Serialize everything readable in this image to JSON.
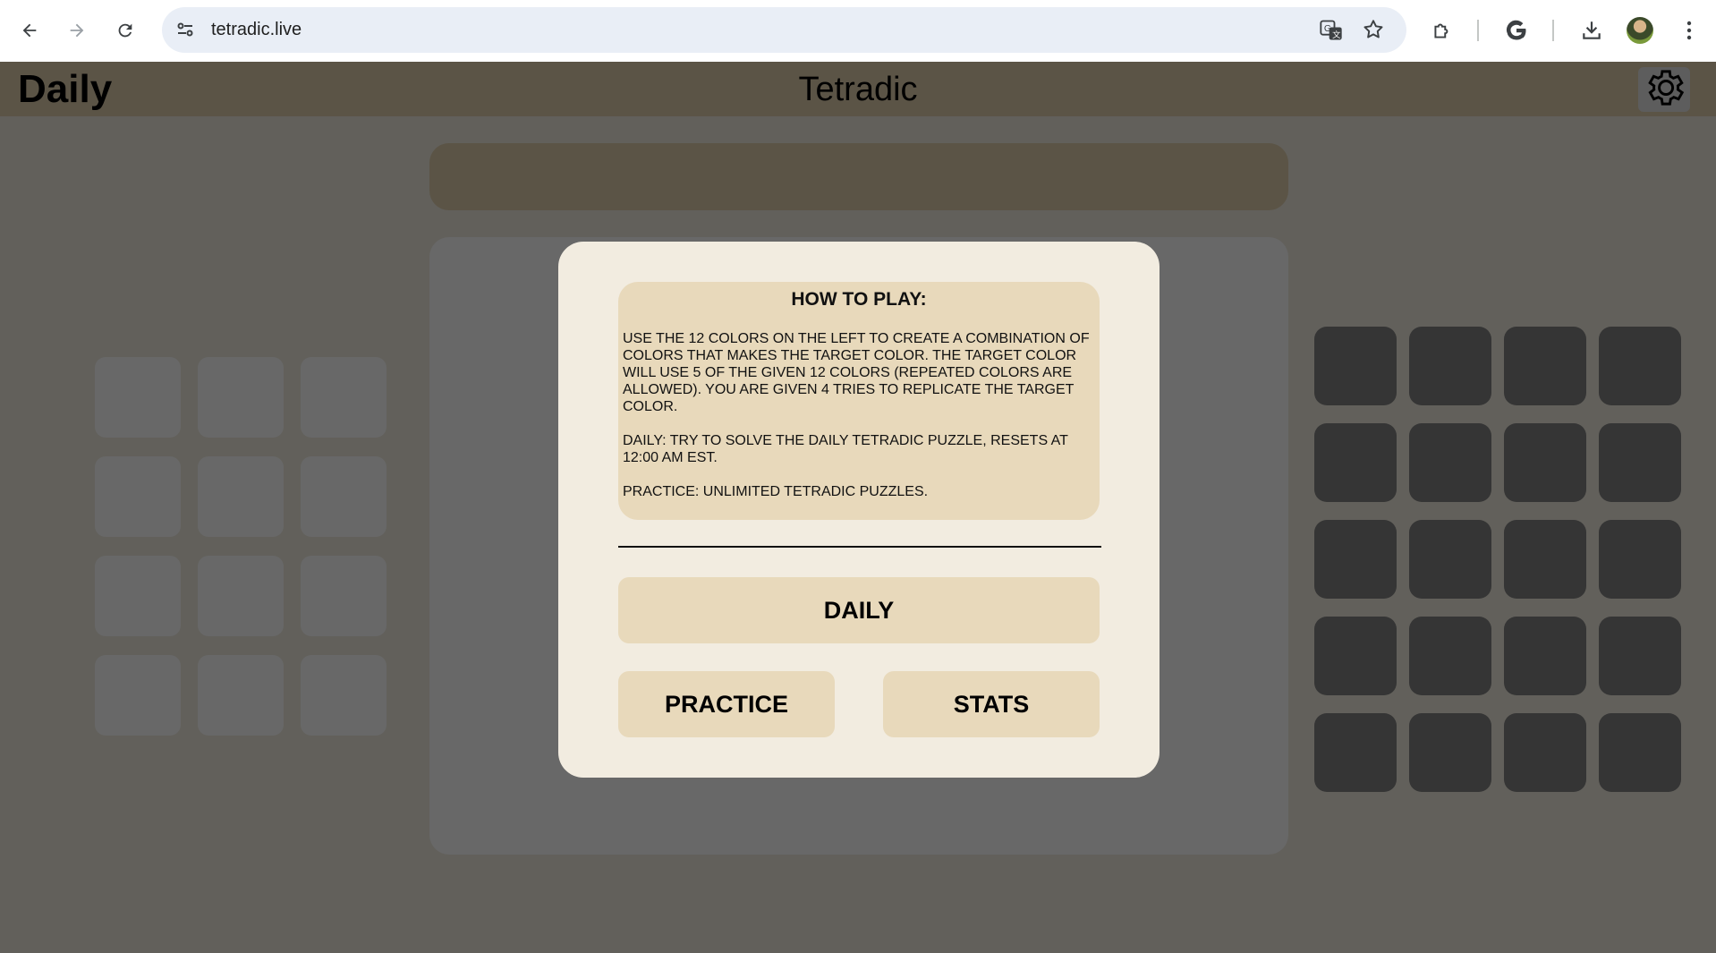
{
  "browser": {
    "url": "tetradic.live",
    "icons": [
      "back-arrow-icon",
      "forward-arrow-icon",
      "reload-icon",
      "site-info-icon",
      "translate-icon",
      "bookmark-star-icon",
      "extensions-icon",
      "google-icon",
      "download-icon",
      "profile-avatar",
      "more-menu-icon"
    ]
  },
  "header": {
    "mode": "Daily",
    "title": "Tetradic",
    "settings_icon": "gear-icon"
  },
  "modal": {
    "help_title": "HOW TO PLAY:",
    "help_paragraph_1": "USE THE 12 COLORS ON THE LEFT TO CREATE A COMBINATION OF COLORS THAT MAKES THE TARGET COLOR. THE TARGET COLOR WILL USE 5 OF THE GIVEN 12 COLORS (REPEATED COLORS ARE ALLOWED). YOU ARE GIVEN 4 TRIES TO REPLICATE THE TARGET COLOR.",
    "help_paragraph_2": "DAILY: TRY TO SOLVE THE DAILY TETRADIC PUZZLE, RESETS AT 12:00 AM EST.",
    "help_paragraph_3": "PRACTICE: UNLIMITED TETRADIC PUZZLES.",
    "daily_button": "DAILY",
    "practice_button": "PRACTICE",
    "stats_button": "STATS"
  },
  "colors": {
    "overlay_background": "#62605b",
    "header_bg": "#5b5446",
    "modal_bg": "#f2ece0",
    "button_bg": "#e8d9bb",
    "try_cell": "#353535",
    "palette_cell": "#686868"
  }
}
